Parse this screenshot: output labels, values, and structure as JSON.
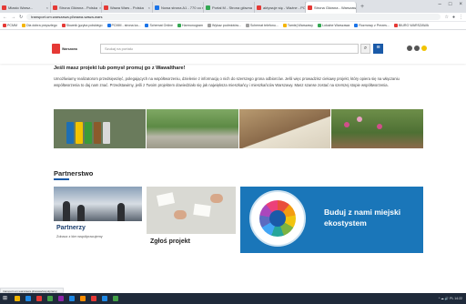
{
  "browser": {
    "tabs": [
      {
        "label": "Miasto Warsz...",
        "color": "#e53935"
      },
      {
        "label": "Strona Główna - Polska",
        "color": "#e53935"
      },
      {
        "label": "Wawa Wars - Polska",
        "color": "#e53935"
      },
      {
        "label": "Nowa strona A1 - 770 co myśli...",
        "color": "#1a73e8"
      },
      {
        "label": "Portal M - Strona główna",
        "color": "#34a853"
      },
      {
        "label": "aktywuje się - Ważne - PCMI",
        "color": "#e53935"
      },
      {
        "label": "Strona Główna - Warszawa",
        "color": "#e53935",
        "active": true
      }
    ],
    "new_tab": "+",
    "window_controls": [
      "–",
      "□",
      "×"
    ],
    "url": "transport.um.warszawa.pl/wawa-wawa-wars",
    "bookmarks": [
      {
        "label": "PCMM",
        "color": "#e53935"
      },
      {
        "label": "Dla dobra przyszłego",
        "color": "#f4b400"
      },
      {
        "label": "Słownik języka polskiego",
        "color": "#e53935"
      },
      {
        "label": "PCMM - strona ka...",
        "color": "#1a73e8"
      },
      {
        "label": "Schemat Online",
        "color": "#1a73e8"
      },
      {
        "label": "Harmonogram",
        "color": "#34a853"
      },
      {
        "label": "Wykaz podmiotów...",
        "color": "#9e9e9e"
      },
      {
        "label": "Schemat telefonu...",
        "color": "#9e9e9e"
      },
      {
        "label": "Tamtej Warszawy",
        "color": "#f4b400"
      },
      {
        "label": "Lokalne Warszawa",
        "color": "#34a853"
      },
      {
        "label": "Rozmowy z Prezes...",
        "color": "#1a73e8"
      },
      {
        "label": "BIURO WARSZAWA",
        "color": "#e53935"
      }
    ]
  },
  "site": {
    "logo_text": "Warszawa",
    "search_placeholder": "Szukaj na portalu",
    "search_icon": "search-icon",
    "menu_icon": "menu-icon"
  },
  "intro": {
    "heading": "Jeśli masz projekt lub pomysł promuj go z Wawalthare!",
    "paragraph": "Umożliwiamy realizatorom przedsięwzięć, polegających na współtworzeniu, dzielenie z informacją o nich do szerszego grona odbiorców. Jeśli więc prowadzisz ciekawy projekt, który opiera się na włączaniu współtworzenia to daj nam znać. Przedstawimy, jeśli z Twoim projektem dowiedziało się jak największa mieszkańcy i mieszkańców Warszawy. Masz szanse zostać na szerszej stopie współtworzenia."
  },
  "gallery": {
    "bin_colors": [
      "#1e6fb3",
      "#f2c300",
      "#3a9a3a",
      "#8b5a2b",
      "#d9d9d9"
    ]
  },
  "section": {
    "title": "Partnerstwo",
    "accent": "#1a5aa8"
  },
  "cards": [
    {
      "title": "Partnerzy",
      "subtitle": "Zobacz z kim współpracujemy"
    },
    {
      "title": "Zgłoś projekt"
    },
    {
      "title": "Buduj z nami miejski ekostystem",
      "color": "#1a76b9"
    }
  ],
  "status_text": "transport.um.warszawa.pl/wawa/wspolpracuj",
  "taskbar": {
    "icon_colors": [
      "#f0b400",
      "#1e88e5",
      "#e53935",
      "#43a047",
      "#8e24aa",
      "#1e88e5",
      "#fb8c00",
      "#e53935",
      "#1e88e5",
      "#43a047"
    ],
    "tray": "^ ☁ 🔊 PL 14:22"
  }
}
